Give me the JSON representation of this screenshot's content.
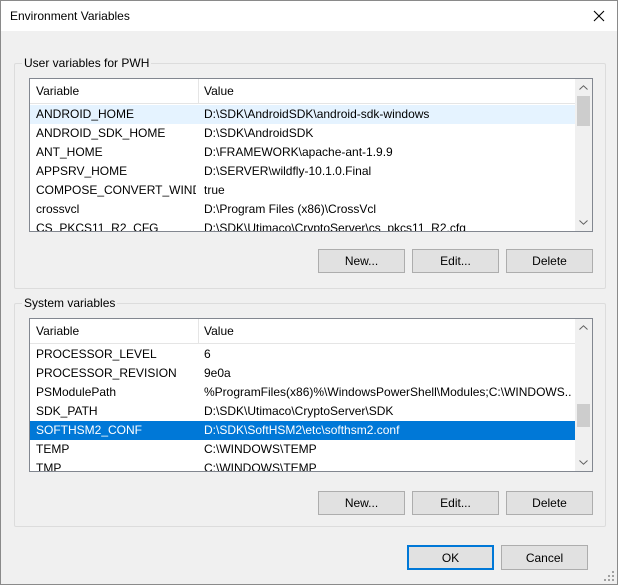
{
  "window": {
    "title": "Environment Variables"
  },
  "user_vars": {
    "group_title": "User variables for PWH",
    "columns": [
      "Variable",
      "Value"
    ],
    "rows": [
      {
        "name": "ANDROID_HOME",
        "value": "D:\\SDK\\AndroidSDK\\android-sdk-windows"
      },
      {
        "name": "ANDROID_SDK_HOME",
        "value": "D:\\SDK\\AndroidSDK"
      },
      {
        "name": "ANT_HOME",
        "value": "D:\\FRAMEWORK\\apache-ant-1.9.9"
      },
      {
        "name": "APPSRV_HOME",
        "value": "D:\\SERVER\\wildfly-10.1.0.Final"
      },
      {
        "name": "COMPOSE_CONVERT_WIND...",
        "value": "true"
      },
      {
        "name": "crossvcl",
        "value": "D:\\Program Files (x86)\\CrossVcl"
      },
      {
        "name": "CS_PKCS11_R2_CFG",
        "value": "D:\\SDK\\Utimaco\\CryptoServer\\cs_pkcs11_R2.cfg"
      }
    ],
    "buttons": {
      "new": "New...",
      "edit": "Edit...",
      "delete": "Delete"
    }
  },
  "system_vars": {
    "group_title": "System variables",
    "columns": [
      "Variable",
      "Value"
    ],
    "rows": [
      {
        "name": "PROCESSOR_LEVEL",
        "value": "6"
      },
      {
        "name": "PROCESSOR_REVISION",
        "value": "9e0a"
      },
      {
        "name": "PSModulePath",
        "value": "%ProgramFiles(x86)%\\WindowsPowerShell\\Modules;C:\\WINDOWS..."
      },
      {
        "name": "SDK_PATH",
        "value": "D:\\SDK\\Utimaco\\CryptoServer\\SDK"
      },
      {
        "name": "SOFTHSM2_CONF",
        "value": "D:\\SDK\\SoftHSM2\\etc\\softhsm2.conf"
      },
      {
        "name": "TEMP",
        "value": "C:\\WINDOWS\\TEMP"
      },
      {
        "name": "TMP",
        "value": "C:\\WINDOWS\\TEMP"
      }
    ],
    "selected_row": "SOFTHSM2_CONF",
    "buttons": {
      "new": "New...",
      "edit": "Edit...",
      "delete": "Delete"
    }
  },
  "dialog_buttons": {
    "ok": "OK",
    "cancel": "Cancel"
  },
  "icons": {
    "close": "close-icon",
    "scroll_up": "chevron-up-icon",
    "scroll_down": "chevron-down-icon",
    "grip": "resize-grip-icon"
  },
  "colors": {
    "selection": "#0078d7",
    "hover": "#e5f3ff",
    "default_border": "#0078d7"
  }
}
